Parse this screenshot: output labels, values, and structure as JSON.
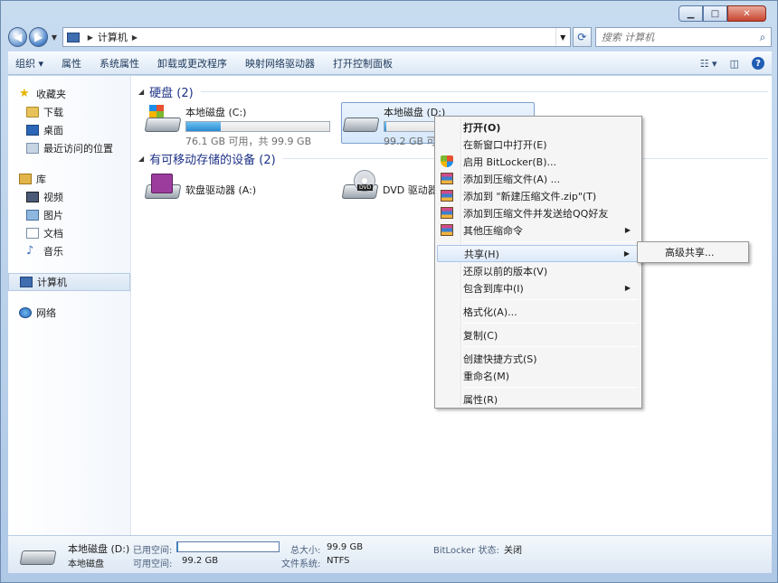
{
  "address": {
    "breadcrumb": "计算机",
    "search_placeholder": "搜索 计算机"
  },
  "toolbar": {
    "organize": "组织 ▾",
    "properties": "属性",
    "system_properties": "系统属性",
    "uninstall": "卸载或更改程序",
    "map_drive": "映射网络驱动器",
    "control_panel": "打开控制面板"
  },
  "sidebar": {
    "favorites": "收藏夹",
    "fav_items": [
      "下载",
      "桌面",
      "最近访问的位置"
    ],
    "libraries": "库",
    "lib_items": [
      "视频",
      "图片",
      "文档",
      "音乐"
    ],
    "computer": "计算机",
    "network": "网络"
  },
  "groups": {
    "hdd": "硬盘 (2)",
    "removable": "有可移动存储的设备 (2)"
  },
  "drives": [
    {
      "name": "本地磁盘 (C:)",
      "free": "76.1 GB 可用，共 99.9 GB",
      "used_fraction": 0.24
    },
    {
      "name": "本地磁盘 (D:)",
      "free": "99.2 GB 可",
      "used_fraction": 0.01
    }
  ],
  "devices": [
    {
      "name": "软盘驱动器 (A:)"
    },
    {
      "name": "DVD 驱动器"
    }
  ],
  "context_menu": {
    "items": [
      "打开(O)",
      "在新窗口中打开(E)",
      "启用 BitLocker(B)...",
      "添加到压缩文件(A) ...",
      "添加到 \"新建压缩文件.zip\"(T)",
      "添加到压缩文件并发送给QQ好友",
      "其他压缩命令",
      "共享(H)",
      "还原以前的版本(V)",
      "包含到库中(I)",
      "格式化(A)...",
      "复制(C)",
      "创建快捷方式(S)",
      "重命名(M)",
      "属性(R)"
    ],
    "submenu_item": "高级共享..."
  },
  "details": {
    "name": "本地磁盘 (D:)",
    "type": "本地磁盘",
    "used_label": "已用空间:",
    "free_label": "可用空间:",
    "free_value": "99.2 GB",
    "total_label": "总大小:",
    "total_value": "99.9 GB",
    "fs_label": "文件系统:",
    "fs_value": "NTFS",
    "bitlocker_label": "BitLocker 状态:",
    "bitlocker_value": "关闭",
    "used_fraction": 0.01
  }
}
